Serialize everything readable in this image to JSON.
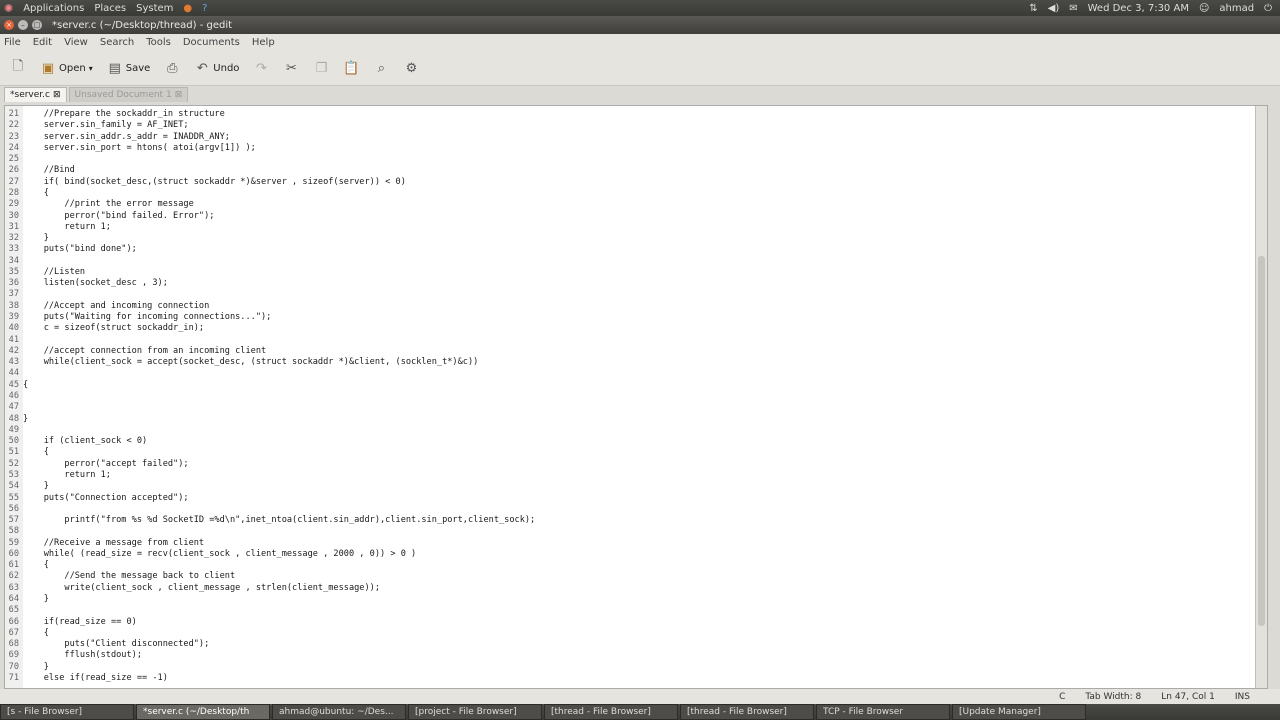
{
  "top_panel": {
    "menus": [
      "Applications",
      "Places",
      "System"
    ],
    "clock": "Wed Dec  3,  7:30 AM",
    "user": "ahmad"
  },
  "window": {
    "title": "*server.c (~/Desktop/thread) - gedit"
  },
  "menubar": [
    "File",
    "Edit",
    "View",
    "Search",
    "Tools",
    "Documents",
    "Help"
  ],
  "toolbar": {
    "open_label": "Open",
    "save_label": "Save",
    "undo_label": "Undo"
  },
  "tabs": [
    {
      "label": "*server.c",
      "active": true
    },
    {
      "label": "Unsaved Document 1",
      "active": false
    }
  ],
  "code_lines": [
    {
      "n": "21",
      "text": "    //Prepare the sockaddr_in structure"
    },
    {
      "n": "22",
      "text": "    server.sin_family = AF_INET;"
    },
    {
      "n": "23",
      "text": "    server.sin_addr.s_addr = INADDR_ANY;"
    },
    {
      "n": "24",
      "text": "    server.sin_port = htons( atoi(argv[1]) );"
    },
    {
      "n": "25",
      "text": ""
    },
    {
      "n": "26",
      "text": "    //Bind"
    },
    {
      "n": "27",
      "text": "    if( bind(socket_desc,(struct sockaddr *)&server , sizeof(server)) < 0)"
    },
    {
      "n": "28",
      "text": "    {"
    },
    {
      "n": "29",
      "text": "        //print the error message"
    },
    {
      "n": "30",
      "text": "        perror(\"bind failed. Error\");"
    },
    {
      "n": "31",
      "text": "        return 1;"
    },
    {
      "n": "32",
      "text": "    }"
    },
    {
      "n": "33",
      "text": "    puts(\"bind done\");"
    },
    {
      "n": "34",
      "text": ""
    },
    {
      "n": "35",
      "text": "    //Listen"
    },
    {
      "n": "36",
      "text": "    listen(socket_desc , 3);"
    },
    {
      "n": "37",
      "text": ""
    },
    {
      "n": "38",
      "text": "    //Accept and incoming connection"
    },
    {
      "n": "39",
      "text": "    puts(\"Waiting for incoming connections...\");"
    },
    {
      "n": "40",
      "text": "    c = sizeof(struct sockaddr_in);"
    },
    {
      "n": "41",
      "text": ""
    },
    {
      "n": "42",
      "text": "    //accept connection from an incoming client"
    },
    {
      "n": "43",
      "text": "    while(client_sock = accept(socket_desc, (struct sockaddr *)&client, (socklen_t*)&c))"
    },
    {
      "n": "44",
      "text": ""
    },
    {
      "n": "45",
      "text": "{"
    },
    {
      "n": "46",
      "text": ""
    },
    {
      "n": "47",
      "text": ""
    },
    {
      "n": "48",
      "text": "}"
    },
    {
      "n": "49",
      "text": ""
    },
    {
      "n": "50",
      "text": "    if (client_sock < 0)"
    },
    {
      "n": "51",
      "text": "    {"
    },
    {
      "n": "52",
      "text": "        perror(\"accept failed\");"
    },
    {
      "n": "53",
      "text": "        return 1;"
    },
    {
      "n": "54",
      "text": "    }"
    },
    {
      "n": "55",
      "text": "    puts(\"Connection accepted\");"
    },
    {
      "n": "56",
      "text": ""
    },
    {
      "n": "57",
      "text": "        printf(\"from %s %d SocketID =%d\\n\",inet_ntoa(client.sin_addr),client.sin_port,client_sock);"
    },
    {
      "n": "58",
      "text": ""
    },
    {
      "n": "59",
      "text": "    //Receive a message from client"
    },
    {
      "n": "60",
      "text": "    while( (read_size = recv(client_sock , client_message , 2000 , 0)) > 0 )"
    },
    {
      "n": "61",
      "text": "    {"
    },
    {
      "n": "62",
      "text": "        //Send the message back to client"
    },
    {
      "n": "63",
      "text": "        write(client_sock , client_message , strlen(client_message));"
    },
    {
      "n": "64",
      "text": "    }"
    },
    {
      "n": "65",
      "text": ""
    },
    {
      "n": "66",
      "text": "    if(read_size == 0)"
    },
    {
      "n": "67",
      "text": "    {"
    },
    {
      "n": "68",
      "text": "        puts(\"Client disconnected\");"
    },
    {
      "n": "69",
      "text": "        fflush(stdout);"
    },
    {
      "n": "70",
      "text": "    }"
    },
    {
      "n": "71",
      "text": "    else if(read_size == -1)"
    }
  ],
  "statusbar": {
    "language": "C",
    "tab_width": "Tab Width: 8",
    "position": "Ln 47, Col 1",
    "mode": "INS"
  },
  "taskbar": [
    {
      "label": "[s - File Browser]",
      "active": false
    },
    {
      "label": "*server.c (~/Desktop/th",
      "active": true
    },
    {
      "label": "ahmad@ubuntu: ~/Des...",
      "active": false
    },
    {
      "label": "[project - File Browser]",
      "active": false
    },
    {
      "label": "[thread - File Browser]",
      "active": false
    },
    {
      "label": "[thread - File Browser]",
      "active": false
    },
    {
      "label": "TCP - File Browser",
      "active": false
    },
    {
      "label": "[Update Manager]",
      "active": false
    }
  ]
}
